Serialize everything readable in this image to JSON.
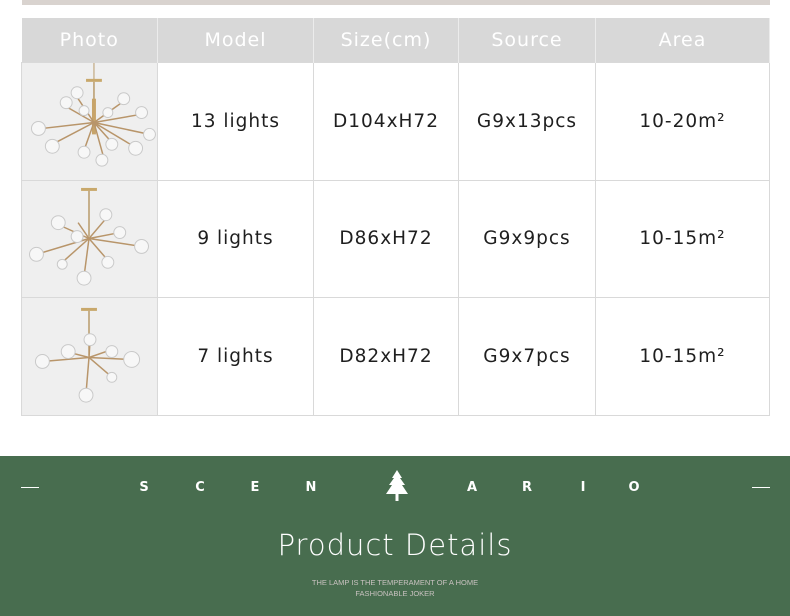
{
  "table": {
    "headers": [
      "Photo",
      "Model",
      "Size(cm)",
      "Source",
      "Area"
    ],
    "rows": [
      {
        "model": "13 lights",
        "size": "D104xH72",
        "source": "G9x13pcs",
        "area": "10-20m²"
      },
      {
        "model": "9 lights",
        "size": "D86xH72",
        "source": "G9x9pcs",
        "area": "10-15m²"
      },
      {
        "model": "7 lights",
        "size": "D82xH72",
        "source": "G9x7pcs",
        "area": "10-15m²"
      }
    ]
  },
  "footer": {
    "letters": [
      "S",
      "C",
      "E",
      "N",
      "A",
      "R",
      "I",
      "O"
    ],
    "title": "Product Details",
    "tagline_1": "THE LAMP IS THE TEMPERAMENT OF A HOME",
    "tagline_2": "FASHIONABLE JOKER",
    "background_color": "#486d4f"
  },
  "icons": {
    "tree": "pine-tree-icon",
    "chandelier": "chandelier-icon"
  }
}
